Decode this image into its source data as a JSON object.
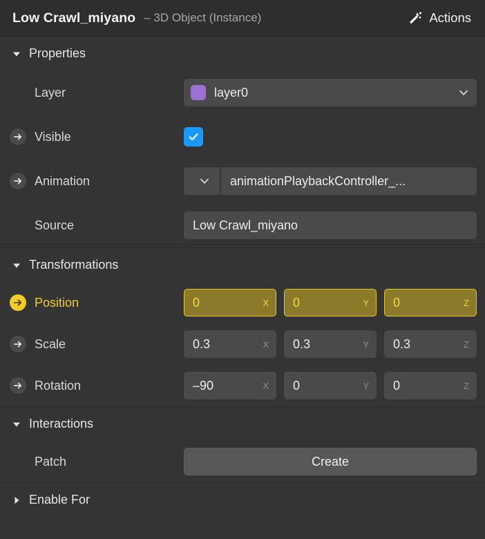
{
  "header": {
    "title": "Low Crawl_miyano",
    "subtitle": "– 3D Object (Instance)",
    "actions_label": "Actions",
    "wand_icon": "magic-wand-icon"
  },
  "colors": {
    "panel_bg": "#343434",
    "header_bg": "#2e2e2e",
    "field_bg": "#4a4a4a",
    "accent_checkbox": "#1a9afe",
    "accent_highlight": "#f2cc26",
    "highlight_field_bg": "#8a7a2a",
    "highlight_field_border": "#e8c52a",
    "layer_swatch": "#9b72d4"
  },
  "sections": {
    "properties": {
      "title": "Properties",
      "expanded": true,
      "triangle": "triangle-down-icon",
      "rows": {
        "layer": {
          "label": "Layer",
          "has_arrow": false,
          "value": "layer0",
          "swatch_color": "#9b72d4",
          "chevron": "chevron-down-icon"
        },
        "visible": {
          "label": "Visible",
          "has_arrow": true,
          "checked": true,
          "check_icon": "checkmark-icon"
        },
        "animation": {
          "label": "Animation",
          "has_arrow": true,
          "chevron": "chevron-down-icon",
          "value": "animationPlaybackController_..."
        },
        "source": {
          "label": "Source",
          "has_arrow": false,
          "value": "Low Crawl_miyano"
        }
      }
    },
    "transformations": {
      "title": "Transformations",
      "expanded": true,
      "triangle": "triangle-down-icon",
      "axes": [
        "X",
        "Y",
        "Z"
      ],
      "rows": {
        "position": {
          "label": "Position",
          "has_arrow": true,
          "highlighted": true,
          "values": [
            "0",
            "0",
            "0"
          ]
        },
        "scale": {
          "label": "Scale",
          "has_arrow": true,
          "highlighted": false,
          "values": [
            "0.3",
            "0.3",
            "0.3"
          ]
        },
        "rotation": {
          "label": "Rotation",
          "has_arrow": true,
          "highlighted": false,
          "values": [
            "–90",
            "0",
            "0"
          ]
        }
      }
    },
    "interactions": {
      "title": "Interactions",
      "expanded": true,
      "triangle": "triangle-down-icon",
      "rows": {
        "patch": {
          "label": "Patch",
          "has_arrow": false,
          "button_label": "Create"
        }
      }
    },
    "enable_for": {
      "title": "Enable For",
      "expanded": false,
      "triangle": "triangle-right-icon"
    }
  }
}
